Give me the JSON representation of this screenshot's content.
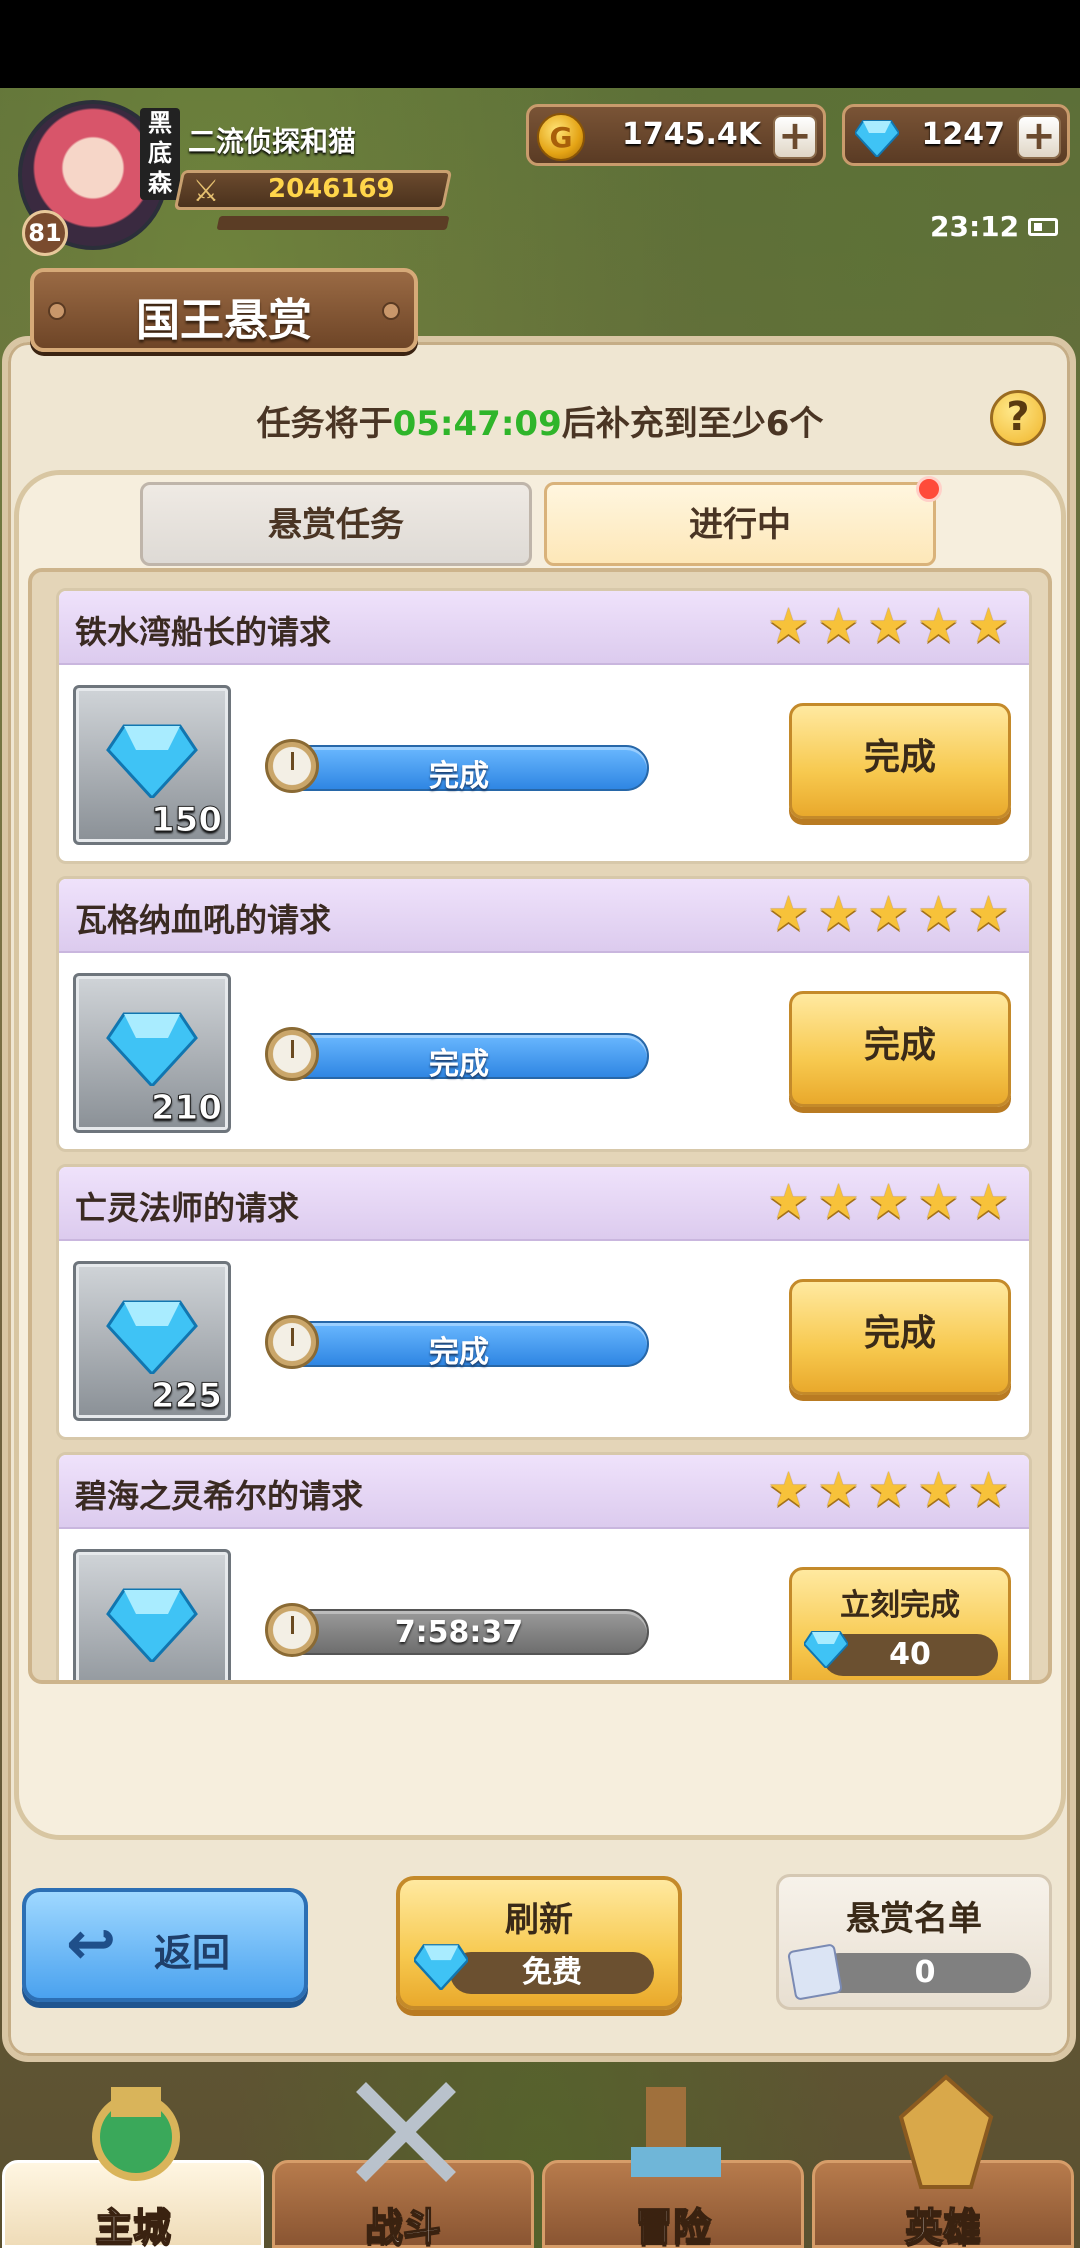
{
  "player": {
    "name": "二流侦探和猫",
    "level": "81",
    "guild_tag": "黑底森",
    "power": "2046169"
  },
  "resources": {
    "gold": "1745.4K",
    "gold_icon_glyph": "G",
    "gems": "1247",
    "plus": "+"
  },
  "status": {
    "time": "23:12"
  },
  "title": "国王悬赏",
  "timer": {
    "prefix": "任务将于",
    "time": "05:47:09",
    "suffix": "后补充到至少6个"
  },
  "help": "?",
  "tabs": [
    {
      "label": "悬赏任务",
      "active": false
    },
    {
      "label": "进行中",
      "active": true
    }
  ],
  "quests": [
    {
      "title": "铁水湾船长的请求",
      "stars": 5,
      "reward": "150",
      "progress": "完成",
      "button": "完成"
    },
    {
      "title": "瓦格纳血吼的请求",
      "stars": 5,
      "reward": "210",
      "progress": "完成",
      "button": "完成"
    },
    {
      "title": "亡灵法师的请求",
      "stars": 5,
      "reward": "225",
      "progress": "完成",
      "button": "完成"
    },
    {
      "title": "碧海之灵希尔的请求",
      "stars": 5,
      "reward": "",
      "progress": "7:58:37",
      "button": "立刻完成",
      "cost": "40"
    }
  ],
  "bottom": {
    "back": "返回",
    "refresh": "刷新",
    "refresh_cost": "免费",
    "bounty_list": "悬赏名单",
    "bounty_count": "0"
  },
  "nav": [
    {
      "label": "主城",
      "icon": "castle-icon"
    },
    {
      "label": "战斗",
      "icon": "crossed-swords-icon"
    },
    {
      "label": "冒险",
      "icon": "map-scroll-icon"
    },
    {
      "label": "英雄",
      "icon": "hero-crest-icon"
    }
  ],
  "colors": {
    "timer_green": "#2fb52a",
    "star": "#f7c23a",
    "progress_blue": "#2f86e3",
    "button_gold": "#f7c94f"
  }
}
